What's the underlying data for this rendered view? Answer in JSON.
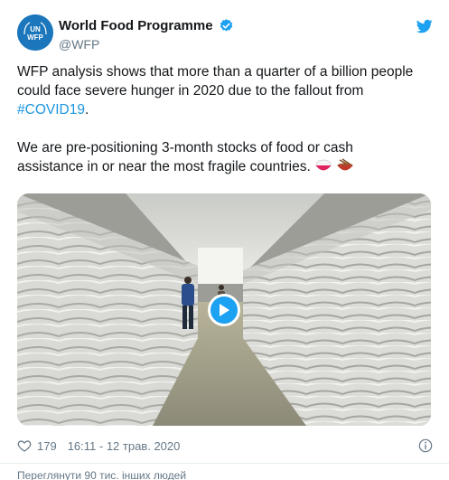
{
  "tweet": {
    "author_name": "World Food Programme",
    "handle": "@WFP",
    "avatar_text_top": "UN",
    "avatar_text_bottom": "WFP",
    "text_line1": "WFP analysis shows that more than a quarter of a billion people",
    "text_line2": "could face severe hunger in 2020 due to the fallout from",
    "hashtag": "#COVID19",
    "hashtag_suffix": ".",
    "text2_line1": "We are pre-positioning 3-month stocks of food or cash",
    "text2_line2": "assistance in or near the most fragile countries.",
    "emojis": [
      "rice-bowl",
      "bowl"
    ]
  },
  "footer": {
    "likes": "179",
    "timestamp": "16:11 - 12 трав. 2020",
    "bottom_partial": "Переглянути 90 тис. інших людей"
  },
  "colors": {
    "accent": "#1da1f2",
    "brand": "#1b76bb",
    "link": "#1b95e0",
    "muted": "#657786"
  },
  "icons": [
    "twitter-bird-icon",
    "verified-badge-icon",
    "heart-icon",
    "info-icon",
    "play-icon"
  ]
}
